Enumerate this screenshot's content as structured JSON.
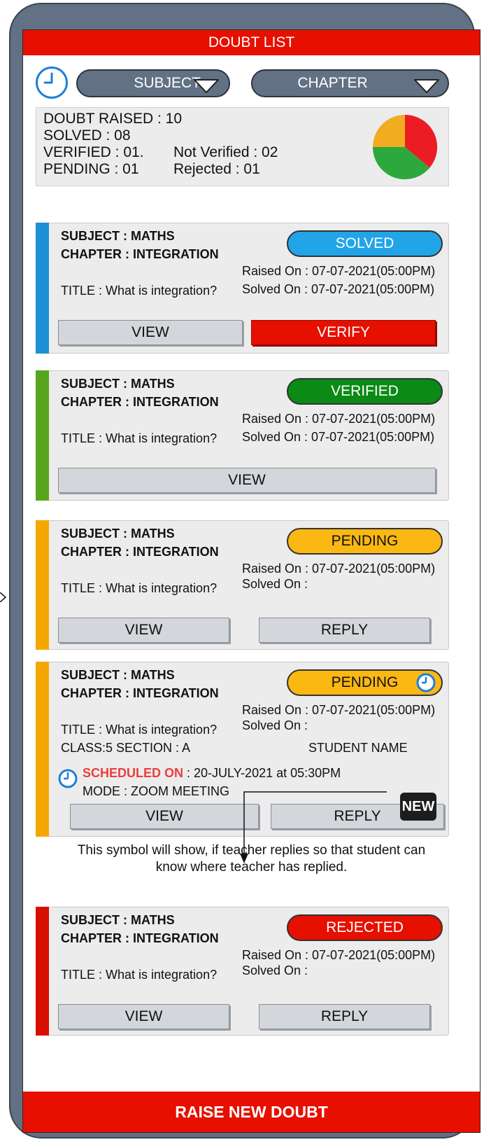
{
  "header": {
    "title": "DOUBT LIST"
  },
  "filters": {
    "subject_label": "SUBJECT",
    "chapter_label": "CHAPTER"
  },
  "stats": {
    "raised": "DOUBT RAISED : 10",
    "solved": "SOLVED : 08",
    "verified": "VERIFIED : 01.",
    "not_verified": "Not Verified : 02",
    "pending": "PENDING : 01",
    "rejected": "Rejected : 01",
    "pie_colors": [
      "#ec1c24",
      "#2ca83c",
      "#f2ac20"
    ]
  },
  "cards": [
    {
      "subject": "SUBJECT :  MATHS",
      "chapter": "CHAPTER : INTEGRATION",
      "status": "SOLVED",
      "status_color": "#22a4e8",
      "raised": "Raised  On :  07-07-2021(05:00PM)",
      "solved": "Solved  On :  07-07-2021(05:00PM)",
      "title": "TITLE : What is integration?",
      "buttons": [
        "VIEW",
        "VERIFY"
      ],
      "strip_color": "#1c8fd6"
    },
    {
      "subject": "SUBJECT :  MATHS",
      "chapter": "CHAPTER : INTEGRATION",
      "status": "VERIFIED",
      "status_color": "#0b8a15",
      "raised": "Raised  On :  07-07-2021(05:00PM)",
      "solved": "Solved  On :  07-07-2021(05:00PM)",
      "title": "TITLE : What is integration?",
      "buttons": [
        "VIEW"
      ],
      "strip_color": "#57a51c"
    },
    {
      "subject": "SUBJECT :  MATHS",
      "chapter": "CHAPTER : INTEGRATION",
      "status": "PENDING",
      "status_color": "#fbb813",
      "raised": "Raised  On :  07-07-2021(05:00PM)",
      "solved": "Solved  On :",
      "title": "TITLE : What is integration?",
      "buttons": [
        "VIEW",
        "REPLY"
      ],
      "strip_color": "#f5a700"
    },
    {
      "subject": "SUBJECT :  MATHS",
      "chapter": "CHAPTER : INTEGRATION",
      "status": "PENDING",
      "status_color": "#fbb813",
      "raised": "Raised  On :  07-07-2021(05:00PM)",
      "solved": "Solved  On :",
      "title": "TITLE : What is integration?",
      "class_section": "CLASS:5   SECTION : A",
      "student_name": "STUDENT NAME",
      "scheduled_label": "SCHEDULED ON",
      "scheduled_value": " : 20-JULY-2021 at 05:30PM",
      "mode": "MODE : ZOOM MEETING",
      "new_badge": "NEW",
      "buttons": [
        "VIEW",
        "REPLY"
      ],
      "strip_color": "#f5a700"
    },
    {
      "subject": "SUBJECT :  MATHS",
      "chapter": "CHAPTER : INTEGRATION",
      "status": "REJECTED",
      "status_color": "#e60f00",
      "raised": "Raised  On :  07-07-2021(05:00PM)",
      "solved": "Solved  On :",
      "title": "TITLE : What is integration?",
      "buttons": [
        "VIEW",
        "REPLY"
      ],
      "strip_color": "#d80f00"
    }
  ],
  "note": {
    "line1": "This symbol will show, if teacher replies so that student can",
    "line2": "know where teacher has replied."
  },
  "footer": {
    "label": "RAISE NEW DOUBT"
  },
  "icons": {
    "clock": "clock-icon",
    "dropdown": "triangle-down-icon",
    "new": "new-badge-icon"
  }
}
